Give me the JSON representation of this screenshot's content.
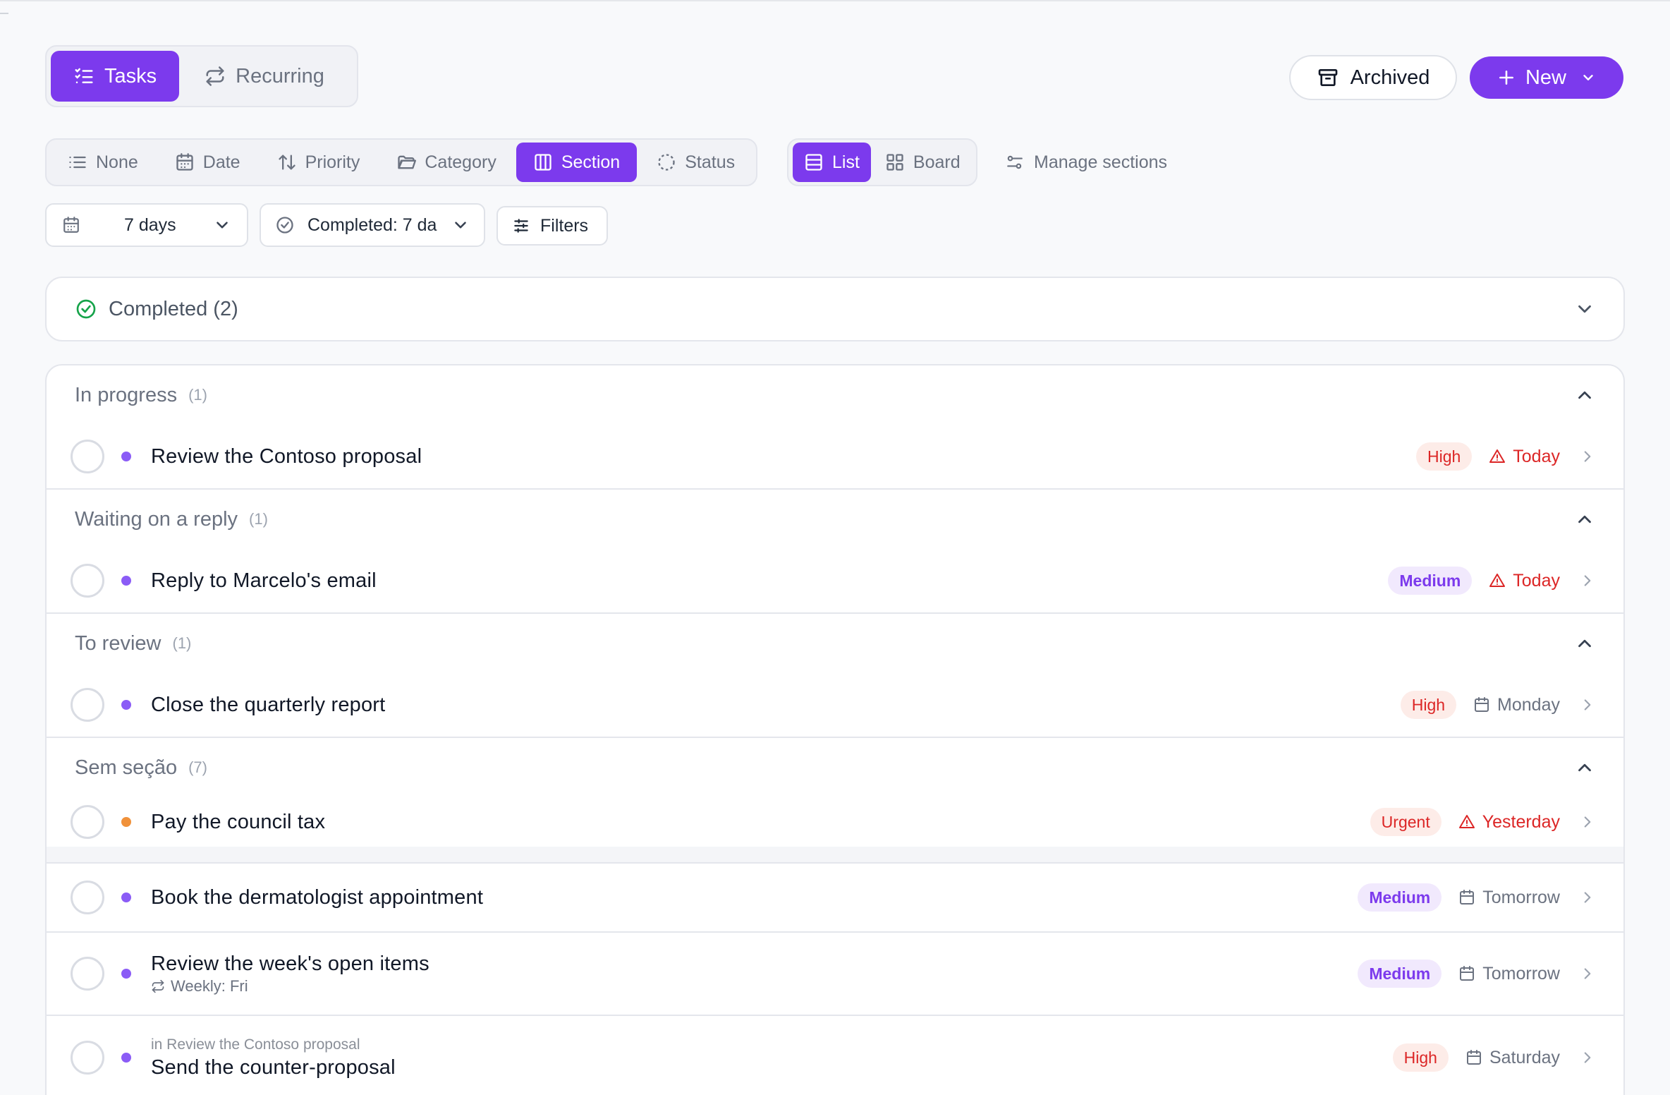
{
  "view_tabs": [
    {
      "label": "Tasks",
      "icon": "task-list-icon",
      "active": true
    },
    {
      "label": "Recurring",
      "icon": "repeat-icon",
      "active": false
    }
  ],
  "actions": {
    "archived_label": "Archived",
    "new_label": "New"
  },
  "group_by": [
    {
      "label": "None",
      "icon": "list-icon",
      "active": false
    },
    {
      "label": "Date",
      "icon": "calendar-icon",
      "active": false
    },
    {
      "label": "Priority",
      "icon": "sort-arrows-icon",
      "active": false
    },
    {
      "label": "Category",
      "icon": "folder-icon",
      "active": false
    },
    {
      "label": "Section",
      "icon": "columns-icon",
      "active": true
    },
    {
      "label": "Status",
      "icon": "dashed-circle-icon",
      "active": false
    }
  ],
  "layout_toggle": [
    {
      "label": "List",
      "icon": "list-layout-icon",
      "active": true
    },
    {
      "label": "Board",
      "icon": "board-grid-icon",
      "active": false
    }
  ],
  "manage_sections_label": "Manage sections",
  "filters": {
    "range_value": "7 days",
    "completed_value": "Completed: 7 da",
    "filters_label": "Filters"
  },
  "completed": {
    "label": "Completed (2)"
  },
  "sections": [
    {
      "title": "In progress",
      "count": "(1)",
      "tasks": [
        {
          "title": "Review the Contoso proposal",
          "priority": "High",
          "due": "Today",
          "overdue": true
        }
      ]
    },
    {
      "title": "Waiting on a reply",
      "count": "(1)",
      "tasks": [
        {
          "title": "Reply to Marcelo's email",
          "priority": "Medium",
          "due": "Today",
          "overdue": true
        }
      ]
    },
    {
      "title": "To review",
      "count": "(1)",
      "tasks": [
        {
          "title": "Close the quarterly report",
          "priority": "High",
          "due": "Monday",
          "overdue": false
        }
      ]
    },
    {
      "title": "Sem seção",
      "count": "(7)",
      "tasks": [
        {
          "title": "Pay the council tax",
          "priority": "Urgent",
          "due": "Yesterday",
          "overdue": true
        },
        {
          "title": "Book the dermatologist appointment",
          "priority": "Medium",
          "due": "Tomorrow",
          "overdue": false
        },
        {
          "title": "Review the week's open items",
          "subtitle": "Weekly: Fri",
          "priority": "Medium",
          "due": "Tomorrow",
          "overdue": false
        },
        {
          "title": "Send the counter-proposal",
          "parent": "in Review the Contoso proposal",
          "priority": "High",
          "due": "Saturday",
          "overdue": false
        }
      ]
    }
  ],
  "colors": {
    "accent": "#7c3aed",
    "purple_dot": "#8b5cf6",
    "orange_dot": "#f0913a",
    "overdue_red": "#dc2626",
    "success_green": "#16a34a"
  }
}
